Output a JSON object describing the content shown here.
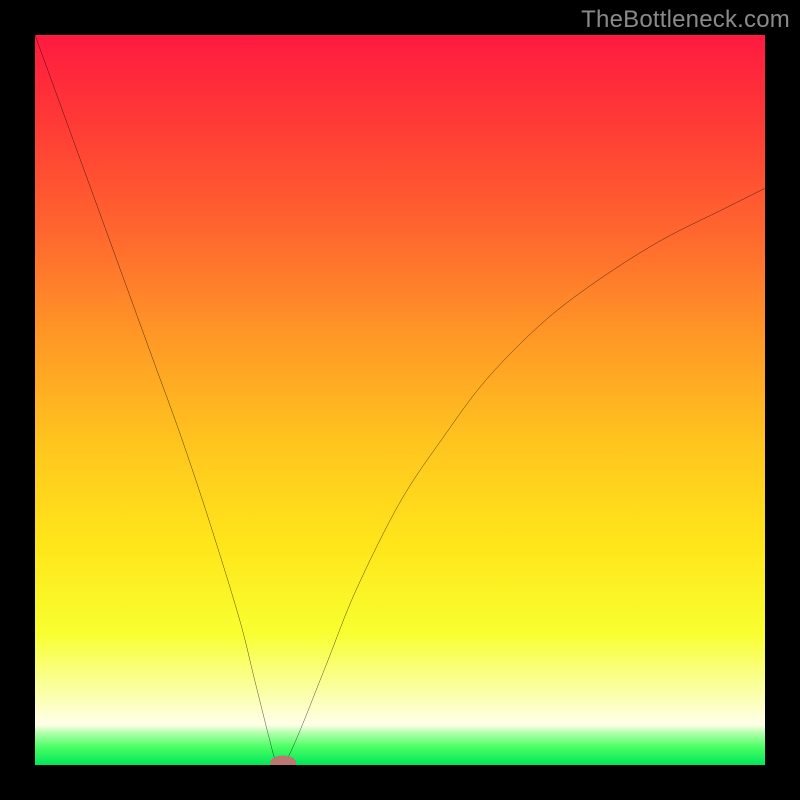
{
  "watermark": "TheBottleneck.com",
  "chart_data": {
    "type": "line",
    "title": "",
    "xlabel": "",
    "ylabel": "",
    "xlim": [
      0,
      100
    ],
    "ylim": [
      0,
      100
    ],
    "x": [
      0,
      4,
      8,
      12,
      16,
      20,
      24,
      28,
      30,
      32,
      33,
      34,
      36,
      40,
      44,
      50,
      56,
      62,
      70,
      78,
      86,
      94,
      100
    ],
    "values": [
      100,
      89,
      78,
      67,
      56,
      45,
      33,
      20,
      12,
      4,
      0.5,
      0,
      4,
      14,
      24,
      36,
      45,
      53,
      61,
      67,
      72,
      76,
      79
    ],
    "minimum_at_x": 34,
    "marker": {
      "x": 34,
      "y": 0.3,
      "rx": 1.8,
      "ry": 1.0,
      "fill": "#bb7771"
    },
    "green_band": {
      "y0": 0,
      "y1": 4.5
    },
    "pale_band": {
      "y0": 4.5,
      "y1": 16
    },
    "gradient": {
      "stops": [
        {
          "offset": 0.0,
          "color": "#ff1a40"
        },
        {
          "offset": 0.12,
          "color": "#ff3a36"
        },
        {
          "offset": 0.28,
          "color": "#ff6a2e"
        },
        {
          "offset": 0.42,
          "color": "#ff9a26"
        },
        {
          "offset": 0.56,
          "color": "#ffc51e"
        },
        {
          "offset": 0.7,
          "color": "#ffe61a"
        },
        {
          "offset": 0.82,
          "color": "#f8ff30"
        },
        {
          "offset": 0.9,
          "color": "#fbffa7"
        },
        {
          "offset": 0.945,
          "color": "#ffffe9"
        },
        {
          "offset": 0.955,
          "color": "#b8ffb0"
        },
        {
          "offset": 0.975,
          "color": "#4cff66"
        },
        {
          "offset": 1.0,
          "color": "#00e658"
        }
      ]
    }
  }
}
